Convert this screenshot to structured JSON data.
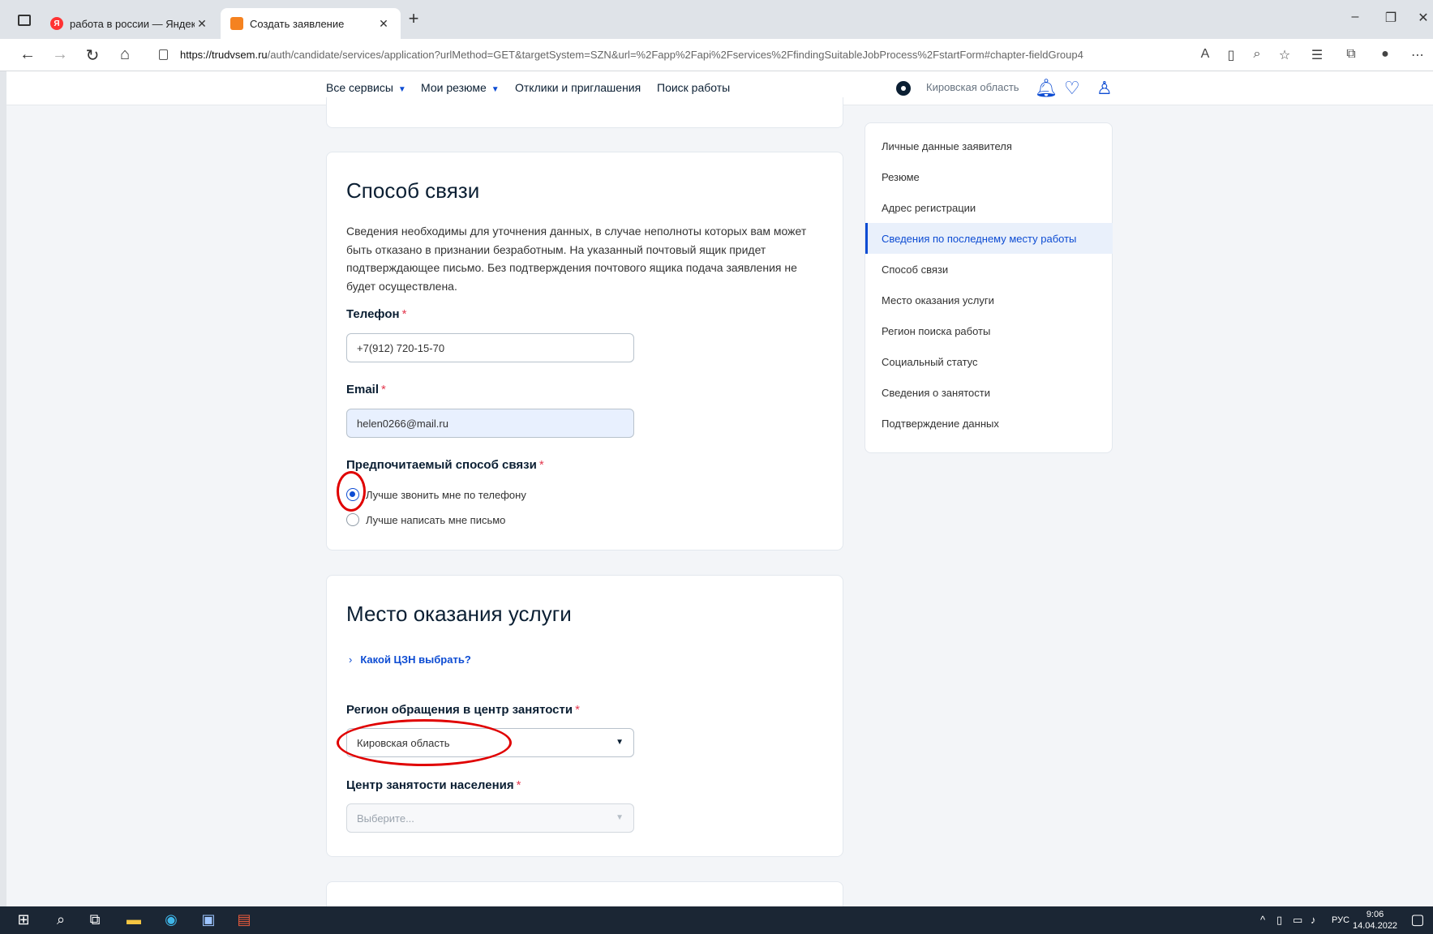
{
  "browser": {
    "tabs": [
      {
        "title": "работа в россии — Яндекс: на"
      },
      {
        "title": "Создать заявление"
      }
    ],
    "url_host": "https://trudvsem.ru",
    "url_path": "/auth/candidate/services/application?urlMethod=GET&targetSystem=SZN&url=%2Fapp%2Fapi%2Fservices%2FfindingSuitableJobProcess%2FstartForm#chapter-fieldGroup4"
  },
  "header": {
    "menu": [
      "Все сервисы",
      "Мои резюме",
      "Отклики и приглашения",
      "Поиск работы"
    ],
    "region": "Кировская область"
  },
  "contact": {
    "title": "Способ связи",
    "description": "Сведения необходимы для уточнения данных, в случае неполноты которых вам может быть отказано в признании безработным. На указанный почтовый ящик придет подтверждающее письмо. Без подтверждения почтового ящика подача заявления не будет осуществлена.",
    "phone_label": "Телефон",
    "phone_value": "+7(912) 720-15-70",
    "email_label": "Email",
    "email_value": "helen0266@mail.ru",
    "pref_label": "Предпочитаемый способ связи",
    "options": [
      "Лучше звонить мне по телефону",
      "Лучше написать мне письмо"
    ],
    "selected_option": 0
  },
  "service": {
    "title": "Место оказания услуги",
    "link": "Какой ЦЗН выбрать?",
    "region_label": "Регион обращения в центр занятости",
    "region_value": "Кировская область",
    "center_label": "Центр занятости населения",
    "center_placeholder": "Выберите..."
  },
  "sidenav": {
    "items": [
      "Личные данные заявителя",
      "Резюме",
      "Адрес регистрации",
      "Сведения по последнему месту работы",
      "Способ связи",
      "Место оказания услуги",
      "Регион поиска работы",
      "Социальный статус",
      "Сведения о занятости",
      "Подтверждение данных"
    ],
    "active_index": 3
  },
  "taskbar": {
    "lang": "РУС",
    "time": "9:06",
    "date": "14.04.2022"
  },
  "colors": {
    "accent": "#0d4cd3",
    "required": "#e3394f",
    "annotation": "#e00000"
  }
}
